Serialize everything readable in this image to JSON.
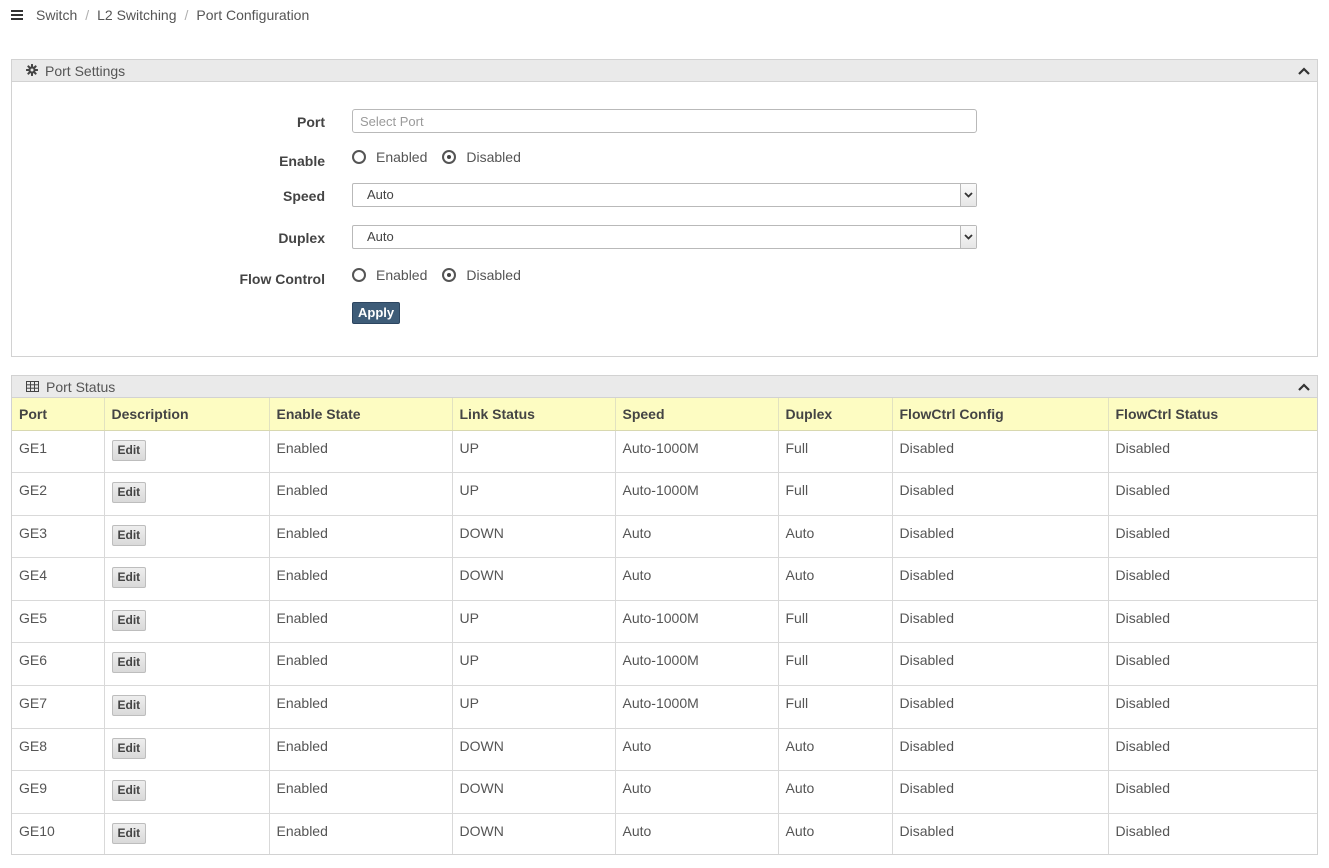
{
  "breadcrumb": [
    "Switch",
    "L2 Switching",
    "Port Configuration"
  ],
  "port_settings": {
    "title": "Port Settings",
    "icons": {
      "header": "gear-icon",
      "collapse": "chevron-up-icon"
    },
    "port": {
      "label": "Port",
      "placeholder": "Select Port",
      "value": ""
    },
    "enable": {
      "label": "Enable",
      "options": [
        "Enabled",
        "Disabled"
      ],
      "selected": "Disabled"
    },
    "speed": {
      "label": "Speed",
      "value": "Auto"
    },
    "duplex": {
      "label": "Duplex",
      "value": "Auto"
    },
    "flow_control": {
      "label": "Flow Control",
      "options": [
        "Enabled",
        "Disabled"
      ],
      "selected": "Disabled"
    },
    "apply_label": "Apply"
  },
  "port_status": {
    "title": "Port Status",
    "icons": {
      "header": "table-icon",
      "collapse": "chevron-up-icon"
    },
    "columns": [
      "Port",
      "Description",
      "Enable State",
      "Link Status",
      "Speed",
      "Duplex",
      "FlowCtrl Config",
      "FlowCtrl Status"
    ],
    "edit_label": "Edit",
    "rows": [
      {
        "port": "GE1",
        "enable_state": "Enabled",
        "link_status": "UP",
        "speed": "Auto-1000M",
        "duplex": "Full",
        "flowctrl_config": "Disabled",
        "flowctrl_status": "Disabled"
      },
      {
        "port": "GE2",
        "enable_state": "Enabled",
        "link_status": "UP",
        "speed": "Auto-1000M",
        "duplex": "Full",
        "flowctrl_config": "Disabled",
        "flowctrl_status": "Disabled"
      },
      {
        "port": "GE3",
        "enable_state": "Enabled",
        "link_status": "DOWN",
        "speed": "Auto",
        "duplex": "Auto",
        "flowctrl_config": "Disabled",
        "flowctrl_status": "Disabled"
      },
      {
        "port": "GE4",
        "enable_state": "Enabled",
        "link_status": "DOWN",
        "speed": "Auto",
        "duplex": "Auto",
        "flowctrl_config": "Disabled",
        "flowctrl_status": "Disabled"
      },
      {
        "port": "GE5",
        "enable_state": "Enabled",
        "link_status": "UP",
        "speed": "Auto-1000M",
        "duplex": "Full",
        "flowctrl_config": "Disabled",
        "flowctrl_status": "Disabled"
      },
      {
        "port": "GE6",
        "enable_state": "Enabled",
        "link_status": "UP",
        "speed": "Auto-1000M",
        "duplex": "Full",
        "flowctrl_config": "Disabled",
        "flowctrl_status": "Disabled"
      },
      {
        "port": "GE7",
        "enable_state": "Enabled",
        "link_status": "UP",
        "speed": "Auto-1000M",
        "duplex": "Full",
        "flowctrl_config": "Disabled",
        "flowctrl_status": "Disabled"
      },
      {
        "port": "GE8",
        "enable_state": "Enabled",
        "link_status": "DOWN",
        "speed": "Auto",
        "duplex": "Auto",
        "flowctrl_config": "Disabled",
        "flowctrl_status": "Disabled"
      },
      {
        "port": "GE9",
        "enable_state": "Enabled",
        "link_status": "DOWN",
        "speed": "Auto",
        "duplex": "Auto",
        "flowctrl_config": "Disabled",
        "flowctrl_status": "Disabled"
      },
      {
        "port": "GE10",
        "enable_state": "Enabled",
        "link_status": "DOWN",
        "speed": "Auto",
        "duplex": "Auto",
        "flowctrl_config": "Disabled",
        "flowctrl_status": "Disabled"
      }
    ]
  },
  "colors": {
    "header_yellow": "#fdfcc2",
    "apply_button": "#3e5c78",
    "panel_header": "#eaeaea"
  }
}
